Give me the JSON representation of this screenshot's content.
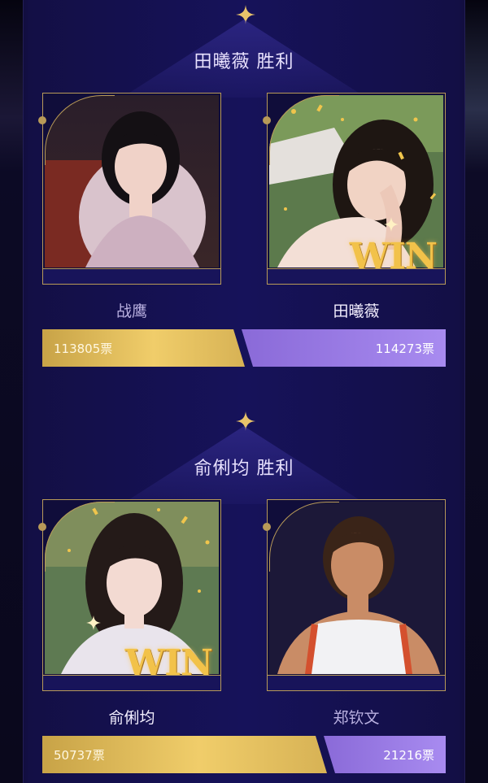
{
  "colors": {
    "gold": "#b89a58",
    "win_gold": "#f2c24a",
    "purple_bar": "#a88bf0",
    "gold_bar": "#f0cd6a",
    "bg": "#16125a"
  },
  "matches": [
    {
      "title": "田曦薇 胜利",
      "left": {
        "name": "战鹰",
        "votes": "113805票",
        "winner": false,
        "vote_count": 113805
      },
      "right": {
        "name": "田曦薇",
        "votes": "114273票",
        "winner": true,
        "vote_count": 114273
      },
      "badge": "WIN"
    },
    {
      "title": "俞俐均 胜利",
      "left": {
        "name": "俞俐均",
        "votes": "50737票",
        "winner": true,
        "vote_count": 50737
      },
      "right": {
        "name": "郑钦文",
        "votes": "21216票",
        "winner": false,
        "vote_count": 21216
      },
      "badge": "WIN"
    }
  ]
}
